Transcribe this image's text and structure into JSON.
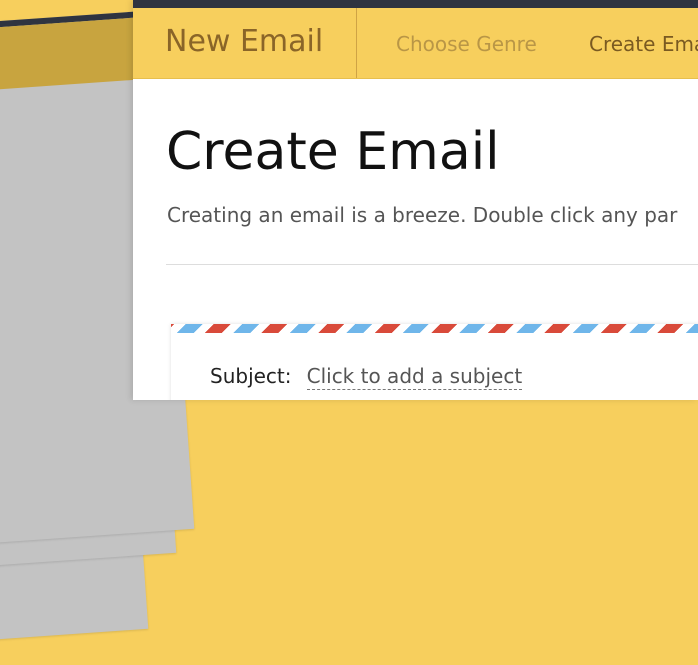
{
  "nav": {
    "brand": "New Email",
    "links": [
      {
        "label": "Choose Genre",
        "state": "inactive"
      },
      {
        "label": "Create Ema",
        "state": "active"
      }
    ]
  },
  "page": {
    "title": "Create Email",
    "subtitle": "Creating an email is a breeze. Double click any par"
  },
  "envelope": {
    "subject_label": "Subject:",
    "subject_placeholder": "Click to add a subject"
  },
  "colors": {
    "background": "#f7cf5d",
    "nav_background": "#f7cf5d",
    "top_bar": "#2f3440",
    "brand_text": "#8a6528",
    "airmail_red": "#d94a3a",
    "airmail_blue": "#6fb6ea"
  }
}
